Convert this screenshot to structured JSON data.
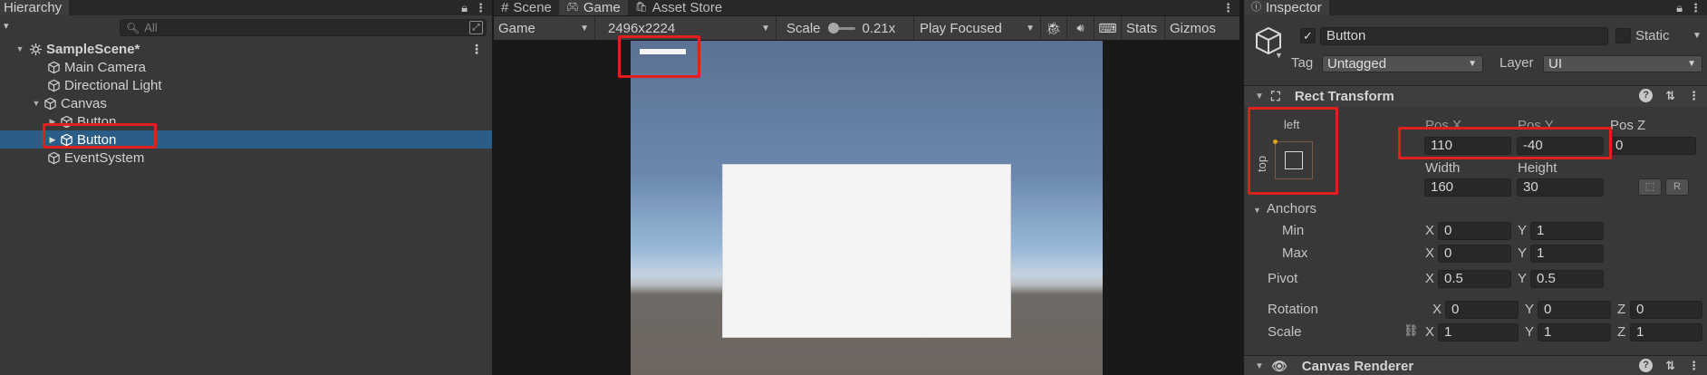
{
  "hierarchy": {
    "tab_label": "Hierarchy",
    "add_caret": "▾",
    "search_placeholder": "All",
    "items": [
      {
        "label": "SampleScene*",
        "arrow": "▼"
      },
      {
        "label": "Main Camera"
      },
      {
        "label": "Directional Light"
      },
      {
        "label": "Canvas",
        "arrow": "▼"
      },
      {
        "label": "Button",
        "arrow": "▶"
      },
      {
        "label": "Button",
        "arrow": "▶"
      },
      {
        "label": "EventSystem"
      }
    ]
  },
  "game_view": {
    "tabs": [
      {
        "label": "Scene",
        "icon": "#"
      },
      {
        "label": "Game",
        "icon": "🎮"
      },
      {
        "label": "Asset Store",
        "icon": "🛍"
      }
    ],
    "display_dropdown": "Game",
    "resolution": "2496x2224",
    "scale_label": "Scale",
    "scale_value": "0.21x",
    "scale_slider_fraction": 0.0,
    "play_mode": "Play Focused",
    "stats_label": "Stats",
    "gizmos_label": "Gizmos"
  },
  "inspector": {
    "tab_label": "Inspector",
    "object_name": "Button",
    "active_checked": true,
    "static_label": "Static",
    "tag_label": "Tag",
    "tag_value": "Untagged",
    "layer_label": "Layer",
    "layer_value": "UI",
    "rect_transform": {
      "title": "Rect Transform",
      "anchor_h": "left",
      "anchor_v": "top",
      "pos_x_label": "Pos X",
      "pos_y_label": "Pos Y",
      "pos_z_label": "Pos Z",
      "pos_x": "110",
      "pos_y": "-40",
      "pos_z": "0",
      "width_label": "Width",
      "height_label": "Height",
      "width": "160",
      "height": "30",
      "anchors_label": "Anchors",
      "min_label": "Min",
      "max_label": "Max",
      "min_x": "0",
      "min_y": "1",
      "max_x": "0",
      "max_y": "1",
      "pivot_label": "Pivot",
      "pivot_x": "0.5",
      "pivot_y": "0.5",
      "rotation_label": "Rotation",
      "rot_x": "0",
      "rot_y": "0",
      "rot_z": "0",
      "scale_label": "Scale",
      "scale_x": "1",
      "scale_y": "1",
      "scale_z": "1",
      "x": "X",
      "y": "Y",
      "z": "Z"
    },
    "canvas_renderer_title": "Canvas Renderer"
  },
  "colors": {
    "selection": "#2c5d87",
    "highlight_red": "#e0201c",
    "panel_bg": "#383838"
  }
}
